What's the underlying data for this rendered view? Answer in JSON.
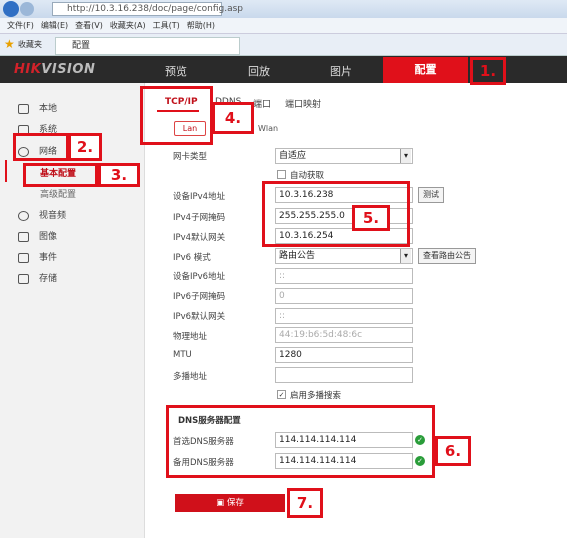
{
  "browser": {
    "url": "http://10.3.16.238/doc/page/config.asp",
    "menu": [
      "文件(F)",
      "编辑(E)",
      "查看(V)",
      "收藏夹(A)",
      "工具(T)",
      "帮助(H)"
    ],
    "favorites": "收藏夹",
    "tab_title": "配置"
  },
  "brand": {
    "logo_red": "HIK",
    "logo_gray": "VISION"
  },
  "nav": [
    "预览",
    "回放",
    "图片",
    "配置"
  ],
  "sidebar": [
    "本地",
    "系统",
    "网络",
    "基本配置",
    "高级配置",
    "视音频",
    "图像",
    "事件",
    "存储"
  ],
  "tabs": [
    "TCP/IP",
    "DDNS",
    "端口",
    "端口映射"
  ],
  "subtabs": [
    "Lan",
    "Wlan"
  ],
  "form": {
    "nic_type_label": "网卡类型",
    "nic_type": "自适应",
    "auto_label": "自动获取",
    "ipv4_label": "设备IPv4地址",
    "ipv4": "10.3.16.238",
    "test": "测试",
    "mask_label": "IPv4子网掩码",
    "mask": "255.255.255.0",
    "gw_label": "IPv4默认网关",
    "gw": "10.3.16.254",
    "ipv6mode_label": "IPv6 模式",
    "ipv6mode": "路由公告",
    "view_route": "查看路由公告",
    "ipv6_label": "设备IPv6地址",
    "ipv6": "::",
    "ipv6mask_label": "IPv6子网掩码",
    "ipv6mask": "0",
    "ipv6gw_label": "IPv6默认网关",
    "ipv6gw": "::",
    "mac_label": "物理地址",
    "mac": "44:19:b6:5d:48:6c",
    "mtu_label": "MTU",
    "mtu": "1280",
    "mcast_label": "多播地址",
    "mcast": "",
    "mcast_search": "启用多播搜索",
    "dns_title": "DNS服务器配置",
    "dns1_label": "首选DNS服务器",
    "dns1": "114.114.114.114",
    "dns2_label": "备用DNS服务器",
    "dns2": "114.114.114.114",
    "save": "保存"
  },
  "steps": [
    "1.",
    "2.",
    "3.",
    "4.",
    "5.",
    "6.",
    "7."
  ],
  "colors": {
    "accent": "#e0101a",
    "nav_bg": "#2a2a2a"
  }
}
